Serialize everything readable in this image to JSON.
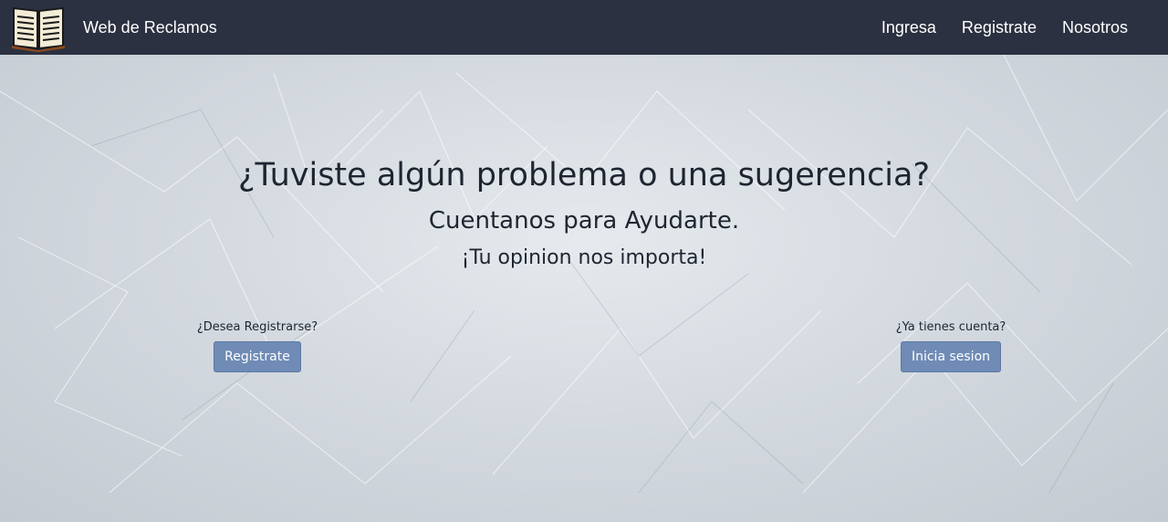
{
  "navbar": {
    "brand": "Web de Reclamos",
    "logo_icon": "open-book-icon",
    "links": [
      {
        "label": "Ingresa"
      },
      {
        "label": "Registrate"
      },
      {
        "label": "Nosotros"
      }
    ],
    "background": "#2b3140"
  },
  "hero": {
    "title": "¿Tuviste algún problema o una sugerencia?",
    "subtitle": "Cuentanos para Ayudarte.",
    "tagline": "¡Tu opinion nos importa!",
    "register": {
      "prompt": "¿Desea Registrarse?",
      "button_label": "Registrate"
    },
    "login": {
      "prompt": "¿Ya tienes cuenta?",
      "button_label": "Inicia sesion"
    },
    "button_color": "#6f8bb6",
    "background_image": "frost-ice-texture"
  }
}
